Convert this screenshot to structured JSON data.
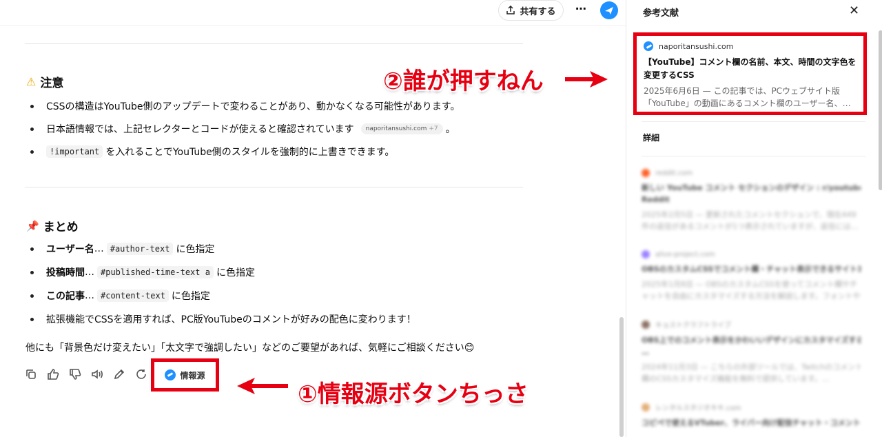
{
  "topbar": {
    "share_label": "共有する",
    "more_label": "⋯"
  },
  "caution": {
    "title": "注意",
    "items": [
      {
        "text": "CSSの構造はYouTube側のアップデートで変わることがあり、動かなくなる可能性があります。"
      },
      {
        "text": "日本語情報では、上記セレクターとコードが使えると確認されています",
        "pill_domain": "naporitansushi.com",
        "pill_more": "+7",
        "suffix": "。"
      },
      {
        "code": "!important",
        "text": "を入れることでYouTube側のスタイルを強制的に上書きできます。"
      }
    ]
  },
  "summary": {
    "title": "まとめ",
    "items": [
      {
        "bold": "ユーザー名",
        "dots": " …",
        "code": "#author-text",
        "text": "に色指定"
      },
      {
        "bold": "投稿時間",
        "dots": " …",
        "code": "#published-time-text a",
        "text": "に色指定"
      },
      {
        "bold": "この記事",
        "dots": " …",
        "code": "#content-text",
        "text": "に色指定"
      },
      {
        "text": "拡張機能でCSSを適用すれば、PC版YouTubeのコメントが好みの配色に変わります！"
      }
    ]
  },
  "closing_text": "他にも「背景色だけ変えたい」「太文字で強調したい」などのご要望があれば、気軽にご相談ください😊",
  "actions": {
    "icons": [
      "copy-icon",
      "thumbs-up-icon",
      "thumbs-down-icon",
      "speaker-icon",
      "edit-icon",
      "regenerate-icon"
    ],
    "source_label": "情報源"
  },
  "annotations": {
    "one": "①情報源ボタンちっさ",
    "two": "②誰が押すねん",
    "color": "#e60012"
  },
  "sidebar": {
    "title": "参考文献",
    "close_label": "✕",
    "featured": {
      "domain": "naporitansushi.com",
      "title": "【YouTube】コメント欄の名前、本文、時間の文字色を変更するCSS",
      "snippet1": "2025年6月6日 — この記事では、PCウェブサイト版",
      "snippet2": "「YouTube」の動画にあるコメント欄のユーザー名、本文、投…"
    },
    "details_label": "詳細",
    "items": [
      {
        "domain": "reddit.com",
        "title": "新しい YouTube コメント セクションのデザイン : r/youtube -",
        "title2": "Reddit",
        "snippet1": "2025年2月5日 — 更新されたコメントセクションで、現在449",
        "snippet2": "件の返信があるコメントが1つ表示されていますが、返信には…",
        "icon_color": "#ff4500"
      },
      {
        "domain": "alive-project.com",
        "title": "OBSのカスタムCSSでコメント欄・チャット表示できるサイト1選",
        "snippet1": "2025年1月8日 — OBSのカスタムCSSを使ってコメント欄やチ",
        "snippet2": "ャットを自由にカスタマイズする方法を解説します。フォントや…",
        "icon_color": "#8a6cff"
      },
      {
        "domain": "キョストクラフトライブ",
        "title": "OBS上でのコメント表示をかわいいデザインにカスタマイズする",
        "title2": "…",
        "snippet1": "2024年11月3日 — こちらの外部ツールでは、Twitchのコメント",
        "snippet2": "欄のCSSカスタマイズ機能を無料で提供しています。…",
        "icon_color": "#7a5a4a"
      },
      {
        "domain": "レンタルスタジオキキ.com",
        "title": "コピペで使えるVTuber、ライバー向け配信チャット・コメント欄",
        "snippet1": "",
        "snippet2": "",
        "icon_color": "#e0a060"
      }
    ]
  }
}
